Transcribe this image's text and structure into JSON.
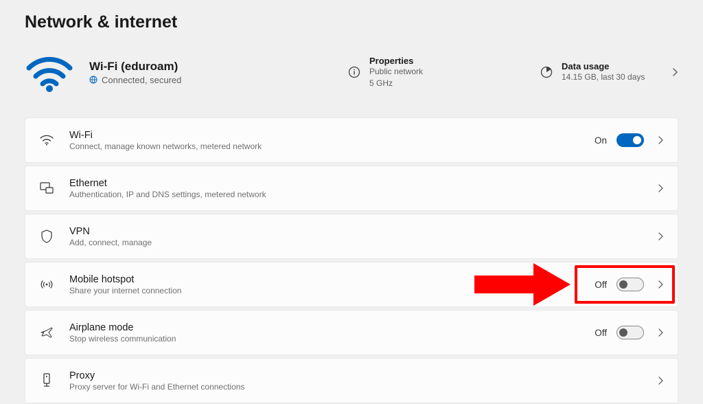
{
  "page": {
    "title": "Network & internet"
  },
  "status": {
    "wifi_name": "Wi-Fi (eduroam)",
    "wifi_status": "Connected, secured",
    "properties": {
      "title": "Properties",
      "line1": "Public network",
      "line2": "5 GHz"
    },
    "usage": {
      "title": "Data usage",
      "sub": "14.15 GB, last 30 days"
    }
  },
  "rows": {
    "wifi": {
      "title": "Wi-Fi",
      "sub": "Connect, manage known networks, metered network",
      "toggle_label": "On"
    },
    "ethernet": {
      "title": "Ethernet",
      "sub": "Authentication, IP and DNS settings, metered network"
    },
    "vpn": {
      "title": "VPN",
      "sub": "Add, connect, manage"
    },
    "hotspot": {
      "title": "Mobile hotspot",
      "sub": "Share your internet connection",
      "toggle_label": "Off"
    },
    "airplane": {
      "title": "Airplane mode",
      "sub": "Stop wireless communication",
      "toggle_label": "Off"
    },
    "proxy": {
      "title": "Proxy",
      "sub": "Proxy server for Wi-Fi and Ethernet connections"
    }
  }
}
